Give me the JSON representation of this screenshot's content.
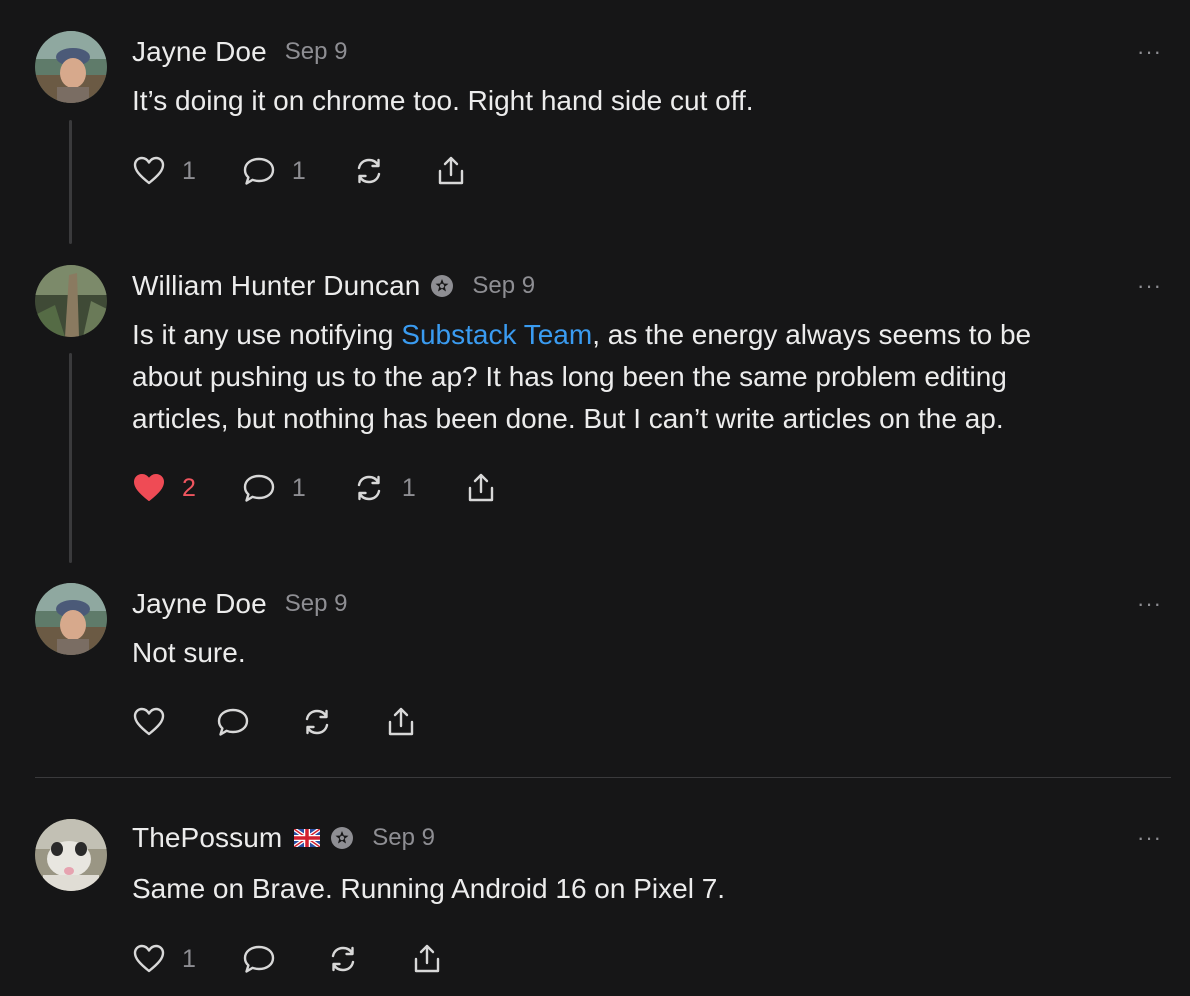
{
  "comments": [
    {
      "author": "Jayne Doe",
      "date": "Sep 9",
      "menu": "···",
      "text": "It’s doing it on chrome too. Right hand side cut off.",
      "likes": "1",
      "replies": "1",
      "restacks": "",
      "liked": false
    },
    {
      "author": "William Hunter Duncan",
      "date": "Sep 9",
      "menu": "···",
      "text_before": "Is it any use notifying ",
      "mention": "Substack Team",
      "text_line1_after": ", as the energy always seems to be",
      "text_line2": "about pushing us to the ap? It has long been the same problem editing",
      "text_line3": "articles, but nothing has been done. But I can’t write articles on the ap.",
      "likes": "2",
      "replies": "1",
      "restacks": "1",
      "liked": true
    },
    {
      "author": "Jayne Doe",
      "date": "Sep 9",
      "menu": "···",
      "text": "Not sure.",
      "likes": "",
      "replies": "",
      "restacks": "",
      "liked": false
    },
    {
      "author": "ThePossum",
      "date": "Sep 9",
      "menu": "···",
      "text": "Same on Brave. Running Android 16 on Pixel 7.",
      "likes": "1",
      "replies": "",
      "restacks": "",
      "liked": false
    }
  ],
  "icons": {
    "like": "heart-icon",
    "reply": "comment-bubble-icon",
    "restack": "restack-icon",
    "share": "share-icon",
    "badge": "subscriber-badge-icon",
    "flag": "uk-flag-icon"
  },
  "colors": {
    "background": "#161617",
    "text": "#ececec",
    "muted": "#8e8e93",
    "mention": "#3a9bf0",
    "liked": "#f0555f"
  }
}
